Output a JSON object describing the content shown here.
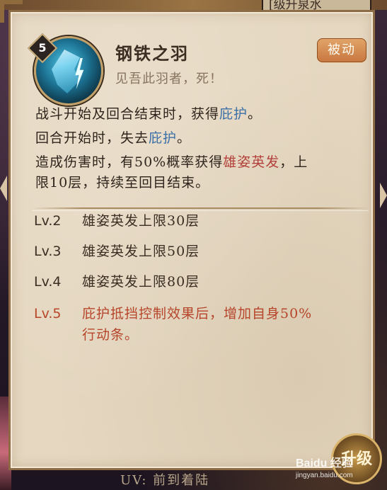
{
  "top_label": "[级升泉水",
  "bottom_caption": "UV: 前到着陆",
  "levelup_button": "升级",
  "skill": {
    "level": "5",
    "name": "钢铁之羽",
    "quote": "见吾此羽者，死！",
    "type_tag": "被动",
    "icon": "feather-wing-icon"
  },
  "description": {
    "line1": {
      "pre": "战斗开始及回合结束时，获得",
      "kw": "庇护",
      "post": "。"
    },
    "line2": {
      "pre": "回合开始时，失去",
      "kw": "庇护",
      "post": "。"
    },
    "line3": {
      "pre": "造成伤害时，有50%概率获得",
      "kw": "雄姿英发",
      "post": "，上"
    },
    "line4": "限10层，持续至回目结束。"
  },
  "upgrades": [
    {
      "level": "Lv.2",
      "text": "雄姿英发上限30层"
    },
    {
      "level": "Lv.3",
      "text": "雄姿英发上限50层"
    },
    {
      "level": "Lv.4",
      "text": "雄姿英发上限80层"
    },
    {
      "level": "Lv.5",
      "text_line1": "庇护抵挡控制效果后，增加自身50%",
      "text_line2": "行动条。"
    }
  ],
  "watermark": {
    "main": "Baidu 经验",
    "sub": "jingyan.baidu.com"
  },
  "colors": {
    "panel_bg": "#e5d7c0",
    "keyword_blue": "#3b6fa6",
    "keyword_red": "#b3403a",
    "highlight_level": "#b6452a",
    "passive_tag": "#d0824a"
  }
}
